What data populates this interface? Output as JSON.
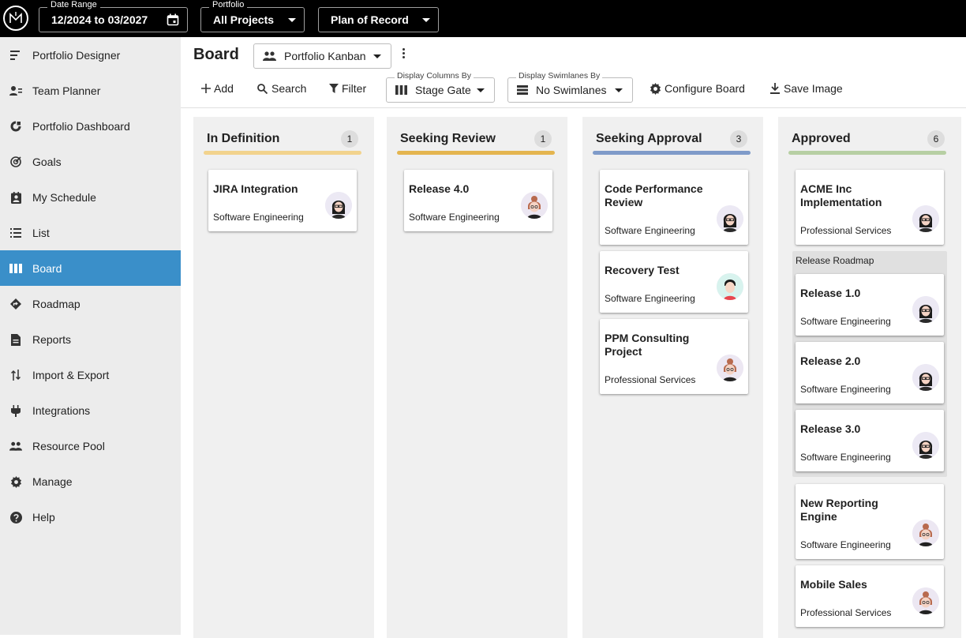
{
  "topbar": {
    "date_range_label": "Date Range",
    "date_range_value": "12/2024 to 03/2027",
    "portfolio_label": "Portfolio",
    "portfolio_value": "All Projects",
    "plan_value": "Plan of Record"
  },
  "sidebar": {
    "items": [
      {
        "label": "Portfolio Designer",
        "icon": "portfolio-designer-icon"
      },
      {
        "label": "Team Planner",
        "icon": "team-planner-icon"
      },
      {
        "label": "Portfolio Dashboard",
        "icon": "dashboard-icon"
      },
      {
        "label": "Goals",
        "icon": "goals-icon"
      },
      {
        "label": "My Schedule",
        "icon": "schedule-icon"
      },
      {
        "label": "List",
        "icon": "list-icon"
      },
      {
        "label": "Board",
        "icon": "board-icon",
        "active": true
      },
      {
        "label": "Roadmap",
        "icon": "roadmap-icon"
      },
      {
        "label": "Reports",
        "icon": "reports-icon"
      },
      {
        "label": "Import & Export",
        "icon": "import-export-icon"
      },
      {
        "label": "Integrations",
        "icon": "plug-icon"
      },
      {
        "label": "Resource Pool",
        "icon": "people-icon"
      },
      {
        "label": "Manage",
        "icon": "gear-icon"
      },
      {
        "label": "Help",
        "icon": "help-icon"
      }
    ],
    "active_color": "#3a8fc9"
  },
  "header": {
    "title": "Board",
    "view_select": "Portfolio Kanban"
  },
  "toolbar": {
    "add": "Add",
    "search": "Search",
    "filter": "Filter",
    "columns_label": "Display Columns By",
    "columns_value": "Stage Gate",
    "swimlanes_label": "Display Swimlanes By",
    "swimlanes_value": "No Swimlanes",
    "configure": "Configure Board",
    "save_image": "Save Image"
  },
  "columns": [
    {
      "title": "In Definition",
      "count": "1",
      "color": "#f2d38d",
      "cards": [
        {
          "title": "JIRA Integration",
          "team": "Software Engineering",
          "avatar": "glasses"
        }
      ]
    },
    {
      "title": "Seeking Review",
      "count": "1",
      "color": "#e4b54f",
      "cards": [
        {
          "title": "Release 4.0",
          "team": "Software Engineering",
          "avatar": "redhair"
        }
      ]
    },
    {
      "title": "Seeking Approval",
      "count": "3",
      "color": "#7f9bc9",
      "cards": [
        {
          "title": "Code Performance Review",
          "team": "Software Engineering",
          "avatar": "glasses"
        },
        {
          "title": "Recovery Test",
          "team": "Software Engineering",
          "avatar": "man"
        },
        {
          "title": "PPM Consulting Project",
          "team": "Professional Services",
          "avatar": "redhair"
        }
      ]
    },
    {
      "title": "Approved",
      "count": "6",
      "color": "#b7cfa3",
      "cards": [
        {
          "title": "ACME Inc Implementation",
          "team": "Professional Services",
          "avatar": "glasses"
        },
        {
          "title": "Release 1.0",
          "team": "Software Engineering",
          "avatar": "glasses"
        },
        {
          "title": "Release 2.0",
          "team": "Software Engineering",
          "avatar": "glasses"
        },
        {
          "title": "Release 3.0",
          "team": "Software Engineering",
          "avatar": "glasses"
        },
        {
          "title": "New Reporting Engine",
          "team": "Software Engineering",
          "avatar": "redhair"
        },
        {
          "title": "Mobile Sales",
          "team": "Professional Services",
          "avatar": "redhair"
        }
      ]
    }
  ],
  "group": {
    "label": "Release Roadmap"
  }
}
